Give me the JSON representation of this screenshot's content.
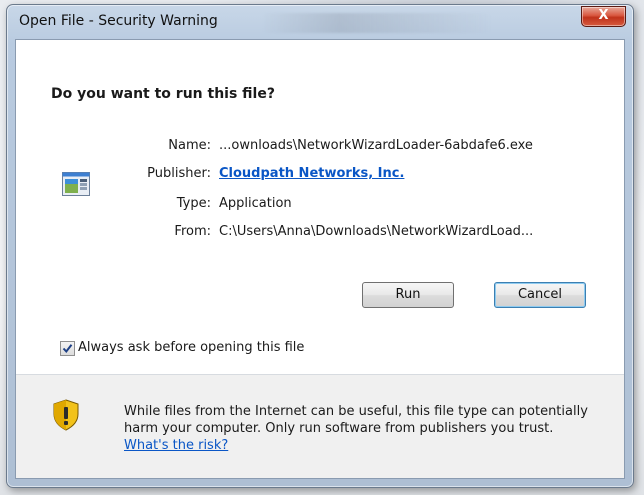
{
  "window": {
    "title": "Open File - Security Warning",
    "close_glyph": "X"
  },
  "dialog": {
    "question": "Do you want to run this file?",
    "file_icon": "application-window-icon",
    "fields": {
      "name_label": "Name:",
      "name_value": "...ownloads\\NetworkWizardLoader-6abdafe6.exe",
      "publisher_label": "Publisher:",
      "publisher_value": "Cloudpath Networks, Inc.",
      "type_label": "Type:",
      "type_value": "Application",
      "from_label": "From:",
      "from_value": "C:\\Users\\Anna\\Downloads\\NetworkWizardLoad..."
    },
    "buttons": {
      "run": "Run",
      "cancel": "Cancel"
    },
    "always_ask": {
      "checked": true,
      "label": "Always ask before opening this file"
    },
    "warning": {
      "icon": "security-shield-icon",
      "text": "While files from the Internet can be useful, this file type can potentially harm your computer. Only run software from publishers you trust.",
      "link": "What's the risk?"
    }
  },
  "colors": {
    "link": "#0a56c6",
    "close_button": "#c0321b",
    "shield_yellow": "#f2c21a",
    "shield_dark": "#2b2b2b"
  }
}
